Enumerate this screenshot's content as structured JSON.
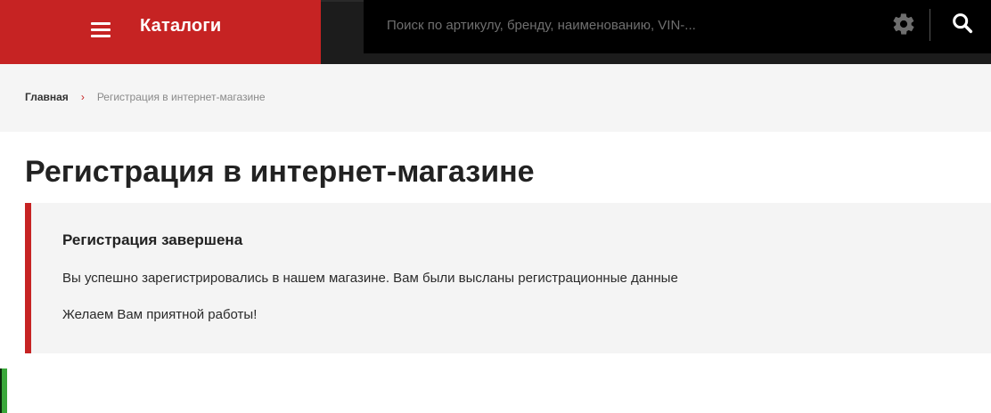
{
  "header": {
    "catalog_label": "Каталоги",
    "search_placeholder": "Поиск по артикулу, бренду, наименованию, VIN-...",
    "icons": [
      "menu-icon",
      "gear-icon",
      "search-icon"
    ]
  },
  "breadcrumb": {
    "home": "Главная",
    "separator": "›",
    "current": "Регистрация в интернет-магазине"
  },
  "page": {
    "title": "Регистрация в интернет-магазине"
  },
  "message": {
    "heading": "Регистрация завершена",
    "line1": "Вы успешно зарегистрировались в нашем магазине. Вам были высланы регистрационные данные",
    "line2": "Желаем Вам приятной работы!"
  },
  "colors": {
    "accent": "#c62323",
    "header_bg": "#1c1c1c",
    "search_bg": "#000000",
    "breadcrumb_bg": "#f5f5f5",
    "message_bg": "#f4f4f4"
  }
}
